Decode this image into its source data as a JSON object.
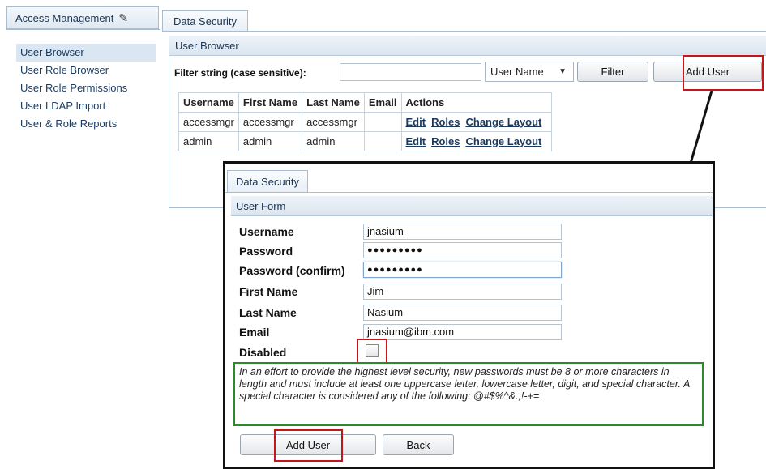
{
  "sidebar": {
    "tab_label": "Access Management",
    "items": [
      {
        "label": "User Browser",
        "active": true
      },
      {
        "label": "User Role Browser"
      },
      {
        "label": "User Role Permissions"
      },
      {
        "label": "User LDAP Import"
      },
      {
        "label": "User & Role Reports"
      }
    ]
  },
  "main": {
    "tab_label": "Data Security",
    "panel_title": "User Browser",
    "filter": {
      "label": "Filter string (case sensitive):",
      "value": "",
      "select_value": "User Name",
      "filter_button": "Filter",
      "add_user_button": "Add User"
    },
    "table": {
      "headers": [
        "Username",
        "First Name",
        "Last Name",
        "Email",
        "Actions"
      ],
      "rows": [
        {
          "username": "accessmgr",
          "first": "accessmgr",
          "last": "accessmgr",
          "email": "",
          "actions": [
            "Edit",
            "Roles",
            "Change Layout"
          ]
        },
        {
          "username": "admin",
          "first": "admin",
          "last": "admin",
          "email": "",
          "actions": [
            "Edit",
            "Roles",
            "Change Layout"
          ]
        }
      ]
    }
  },
  "dialog": {
    "tab_label": "Data Security",
    "form_title": "User Form",
    "fields": {
      "username": {
        "label": "Username",
        "value": "jnasium"
      },
      "password": {
        "label": "Password",
        "value": "●●●●●●●●●"
      },
      "password_confirm": {
        "label": "Password (confirm)",
        "value": "●●●●●●●●●"
      },
      "first_name": {
        "label": "First Name",
        "value": "Jim"
      },
      "last_name": {
        "label": "Last Name",
        "value": "Nasium"
      },
      "email": {
        "label": "Email",
        "value": "jnasium@ibm.com"
      },
      "disabled": {
        "label": "Disabled",
        "checked": false
      }
    },
    "notice": "In an effort to provide the highest level security, new passwords must be 8 or more characters in length and must include at least one uppercase letter, lowercase letter, digit, and special character. A special character is considered any of the following: @#$%^&.;!-+=",
    "add_button": "Add User",
    "back_button": "Back"
  },
  "icons": {
    "edit": "pencil-icon",
    "dropdown": "chevron-down-icon",
    "arrow": "pointer-arrow"
  },
  "colors": {
    "highlight_red": "#c4151c",
    "notice_green": "#2b8a2b",
    "header_blue": "#dbe5ef",
    "link_blue": "#1b3a5e"
  }
}
